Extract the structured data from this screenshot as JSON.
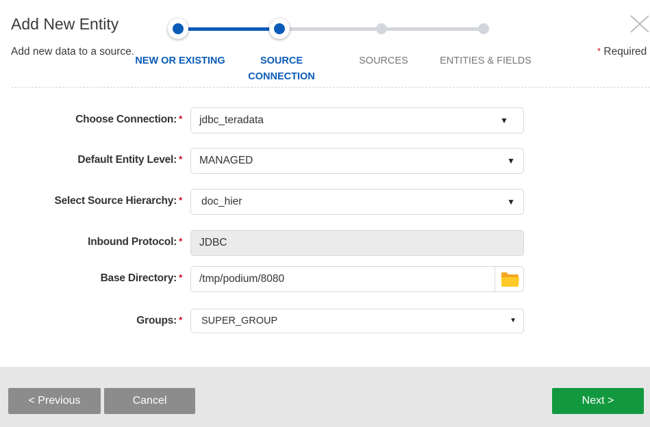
{
  "header": {
    "title": "Add New Entity",
    "subtitle": "Add new data to a source.",
    "required_star": "*",
    "required_label": "Required",
    "close_icon": "close-x-icon"
  },
  "stepper": {
    "current_step": 2,
    "total_steps": 4,
    "steps": [
      {
        "line1": "NEW OR EXISTING",
        "line2": "",
        "status": "done"
      },
      {
        "line1": "SOURCE",
        "line2": "CONNECTION",
        "status": "current"
      },
      {
        "line1": "SOURCES",
        "line2": "",
        "status": "pending"
      },
      {
        "line1": "ENTITIES & FIELDS",
        "line2": "",
        "status": "pending"
      }
    ],
    "colors": {
      "active": "#0a5bb8",
      "inactive": "#d3d6dc"
    }
  },
  "form": {
    "required_star": "*",
    "fields": [
      {
        "label": "Choose Connection:",
        "value": "jdbc_teradata",
        "type": "select",
        "icon": "caret-down-icon"
      },
      {
        "label": "Default Entity Level:",
        "value": "MANAGED",
        "type": "select",
        "icon": "caret-down-icon"
      },
      {
        "label": "Select Source Hierarchy:",
        "value": "doc_hier",
        "type": "select",
        "icon": "caret-down-icon"
      },
      {
        "label": "Inbound Protocol:",
        "value": "JDBC",
        "type": "readonly"
      },
      {
        "label": "Base Directory:",
        "value": "/tmp/podium/8080",
        "type": "text",
        "icon": "folder-icon"
      },
      {
        "label": "Groups:",
        "value": "SUPER_GROUP",
        "type": "select",
        "icon": "caret-down-icon"
      }
    ],
    "caret_glyph": "▼"
  },
  "footer": {
    "previous_label": "< Previous",
    "cancel_label": "Cancel",
    "next_label": "Next >",
    "colors": {
      "secondary": "#8c8c8c",
      "primary": "#12993f"
    }
  }
}
